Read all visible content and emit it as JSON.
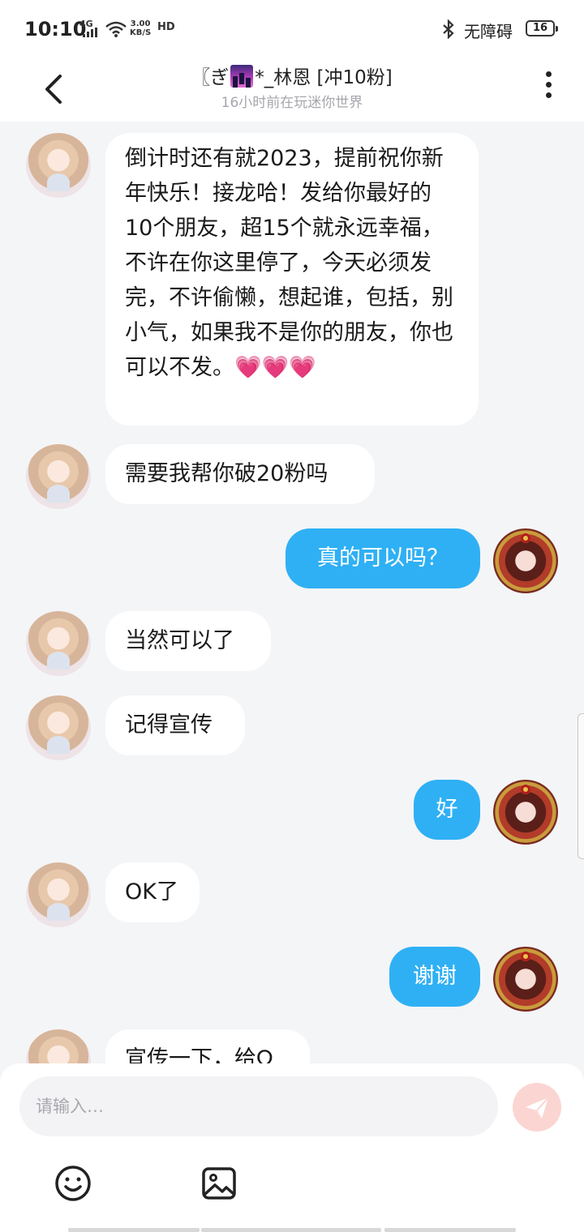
{
  "status_bar": {
    "time": "10:10",
    "network": "4G",
    "speed_value": "3.00",
    "speed_unit": "KB/S",
    "hd": "HD",
    "accessibility": "无障碍",
    "battery": "16"
  },
  "header": {
    "title_prefix": "〖ぎ",
    "title_suffix": "*_林恩 [冲10粉]",
    "subtitle": "16小时前在玩迷你世界"
  },
  "messages": [
    {
      "side": "in",
      "text": "倒计时还有就2023，提前祝你新年快乐！接龙哈！发给你最好的10个朋友，超15个就永远幸福，不许在你这里停了，今天必须发完，不许偷懒，想起谁，包括，别小气，如果我不是你的朋友，你也可以不发。💗💗💗"
    },
    {
      "side": "in",
      "text": "需要我帮你破20粉吗"
    },
    {
      "side": "out",
      "text": "真的可以吗？"
    },
    {
      "side": "in",
      "text": "当然可以了"
    },
    {
      "side": "in",
      "text": "记得宣传"
    },
    {
      "side": "out",
      "text": "好"
    },
    {
      "side": "in",
      "text": "OK了"
    },
    {
      "side": "out",
      "text": "谢谢"
    },
    {
      "side": "in",
      "text": "宣传一下，给Ω"
    }
  ],
  "input": {
    "placeholder": "请输入…"
  },
  "colors": {
    "outgoing_bubble": "#2fb0f4",
    "incoming_bubble": "#ffffff",
    "background": "#f4f5f7",
    "send_button": "#fbd5d2"
  },
  "icons": {
    "back": "chevron-left-icon",
    "more": "more-vertical-icon",
    "send": "paper-plane-icon",
    "emoji": "smiley-icon",
    "image": "image-icon"
  }
}
